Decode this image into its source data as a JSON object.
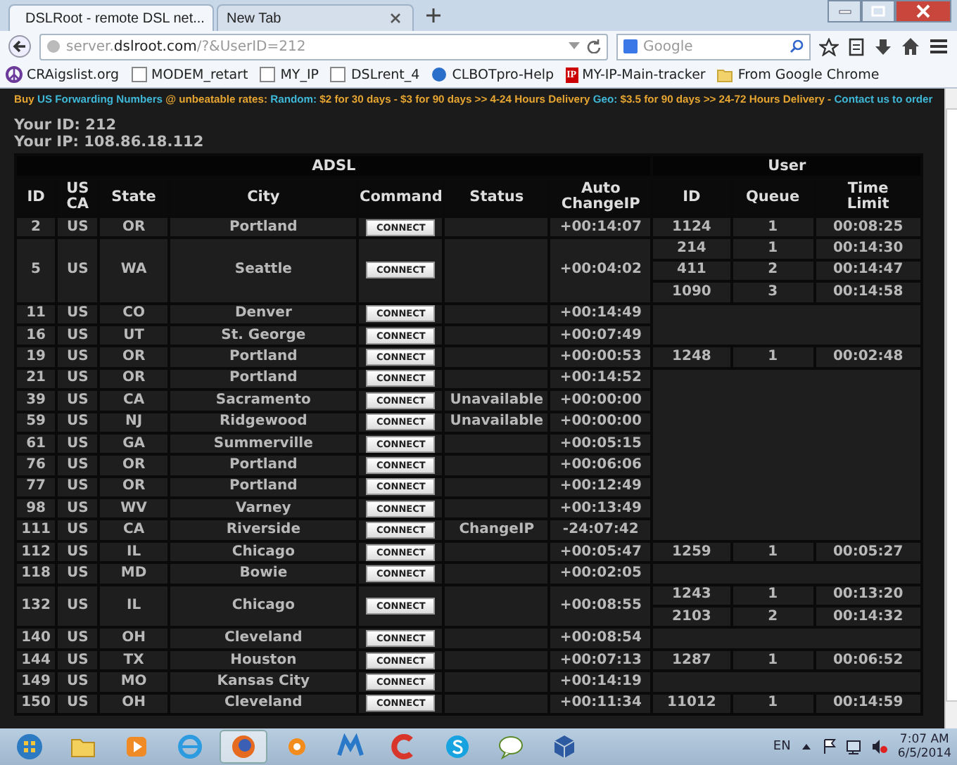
{
  "tabs": [
    {
      "label": "DSLRoot - remote DSL net...",
      "selected": true
    },
    {
      "label": "New Tab",
      "selected": false
    }
  ],
  "address": {
    "prefix": "server.",
    "domain": "dslroot.com",
    "path": "/?&UserID=212"
  },
  "search": {
    "placeholder": "Google"
  },
  "bookmarks": [
    {
      "label": "CRAigslist.org",
      "kind": "peace"
    },
    {
      "label": "MODEM_retart",
      "kind": "page"
    },
    {
      "label": "MY_IP",
      "kind": "page"
    },
    {
      "label": "DSLrent_4",
      "kind": "page"
    },
    {
      "label": "CLBOTpro-Help",
      "kind": "globe"
    },
    {
      "label": "MY-IP-Main-tracker",
      "kind": "ip",
      "badge": "IP"
    },
    {
      "label": "From Google Chrome",
      "kind": "folder"
    }
  ],
  "banner": [
    {
      "text": "Buy ",
      "kind": "text"
    },
    {
      "text": "US Forwarding Numbers",
      "kind": "link"
    },
    {
      "text": " @ unbeatable rates: ",
      "kind": "text"
    },
    {
      "text": "Random:",
      "kind": "link"
    },
    {
      "text": " $2 for 30 days - $3 for 90 days >> 4-24 Hours Delivery ",
      "kind": "text"
    },
    {
      "text": "Geo:",
      "kind": "link"
    },
    {
      "text": " $3.5 for 90 days >> 24-72 Hours Delivery - ",
      "kind": "text"
    },
    {
      "text": "Contact us to order",
      "kind": "link"
    }
  ],
  "your_id": "Your ID: 212",
  "your_ip": "Your IP: 108.86.18.112",
  "table": {
    "groups": [
      "ADSL",
      "User"
    ],
    "columns": [
      "ID",
      "US CA",
      "State",
      "City",
      "Command",
      "Status",
      "Auto ChangeIP",
      "ID",
      "Queue",
      "Time Limit"
    ],
    "rows": [
      {
        "id": "2",
        "country": "US",
        "state": "OR",
        "city": "Portland",
        "command": "CONNECT",
        "auto_changeip": "+00:14:07",
        "users": [
          {
            "id": "1124",
            "queue": "1",
            "time_limit": "00:08:25"
          }
        ]
      },
      {
        "id": "5",
        "country": "US",
        "state": "WA",
        "city": "Seattle",
        "command": "CONNECT",
        "auto_changeip": "+00:04:02",
        "users": [
          {
            "id": "214",
            "queue": "1",
            "time_limit": "00:14:30"
          },
          {
            "id": "411",
            "queue": "2",
            "time_limit": "00:14:47"
          },
          {
            "id": "1090",
            "queue": "3",
            "time_limit": "00:14:58"
          }
        ]
      },
      {
        "id": "11",
        "country": "US",
        "state": "CO",
        "city": "Denver",
        "command": "CONNECT",
        "auto_changeip": "+00:14:49",
        "users": []
      },
      {
        "id": "16",
        "country": "US",
        "state": "UT",
        "city": "St. George",
        "command": "CONNECT",
        "auto_changeip": "+00:07:49",
        "users": []
      },
      {
        "id": "19",
        "country": "US",
        "state": "OR",
        "city": "Portland",
        "command": "CONNECT",
        "auto_changeip": "+00:00:53",
        "users": [
          {
            "id": "1248",
            "queue": "1",
            "time_limit": "00:02:48"
          }
        ]
      },
      {
        "id": "21",
        "country": "US",
        "state": "OR",
        "city": "Portland",
        "command": "CONNECT",
        "auto_changeip": "+00:14:52",
        "users": []
      },
      {
        "id": "39",
        "country": "US",
        "state": "CA",
        "city": "Sacramento",
        "command": "CONNECT",
        "status": "Unavailable",
        "auto_changeip": "+00:00:00",
        "users": []
      },
      {
        "id": "59",
        "country": "US",
        "state": "NJ",
        "city": "Ridgewood",
        "command": "CONNECT",
        "status": "Unavailable",
        "auto_changeip": "+00:00:00",
        "users": []
      },
      {
        "id": "61",
        "country": "US",
        "state": "GA",
        "city": "Summerville",
        "command": "CONNECT",
        "auto_changeip": "+00:05:15",
        "users": []
      },
      {
        "id": "76",
        "country": "US",
        "state": "OR",
        "city": "Portland",
        "command": "CONNECT",
        "auto_changeip": "+00:06:06",
        "users": []
      },
      {
        "id": "77",
        "country": "US",
        "state": "OR",
        "city": "Portland",
        "command": "CONNECT",
        "auto_changeip": "+00:12:49",
        "users": []
      },
      {
        "id": "98",
        "country": "US",
        "state": "WV",
        "city": "Varney",
        "command": "CONNECT",
        "auto_changeip": "+00:13:49",
        "users": []
      },
      {
        "id": "111",
        "country": "US",
        "state": "CA",
        "city": "Riverside",
        "command": "CONNECT",
        "status": "ChangeIP",
        "auto_changeip": "-24:07:42",
        "users": []
      },
      {
        "id": "112",
        "country": "US",
        "state": "IL",
        "city": "Chicago",
        "command": "CONNECT",
        "auto_changeip": "+00:05:47",
        "users": [
          {
            "id": "1259",
            "queue": "1",
            "time_limit": "00:05:27"
          }
        ]
      },
      {
        "id": "118",
        "country": "US",
        "state": "MD",
        "city": "Bowie",
        "command": "CONNECT",
        "auto_changeip": "+00:02:05",
        "users": []
      },
      {
        "id": "132",
        "country": "US",
        "state": "IL",
        "city": "Chicago",
        "command": "CONNECT",
        "auto_changeip": "+00:08:55",
        "users": [
          {
            "id": "1243",
            "queue": "1",
            "time_limit": "00:13:20"
          },
          {
            "id": "2103",
            "queue": "2",
            "time_limit": "00:14:32"
          }
        ]
      },
      {
        "id": "140",
        "country": "US",
        "state": "OH",
        "city": "Cleveland",
        "command": "CONNECT",
        "auto_changeip": "+00:08:54",
        "users": []
      },
      {
        "id": "144",
        "country": "US",
        "state": "TX",
        "city": "Houston",
        "command": "CONNECT",
        "auto_changeip": "+00:07:13",
        "users": [
          {
            "id": "1287",
            "queue": "1",
            "time_limit": "00:06:52"
          }
        ]
      },
      {
        "id": "149",
        "country": "US",
        "state": "MO",
        "city": "Kansas City",
        "command": "CONNECT",
        "auto_changeip": "+00:14:19",
        "users": []
      },
      {
        "id": "150",
        "country": "US",
        "state": "OH",
        "city": "Cleveland",
        "command": "CONNECT",
        "auto_changeip": "+00:11:34",
        "users": [
          {
            "id": "11012",
            "queue": "1",
            "time_limit": "00:14:59"
          }
        ]
      }
    ]
  },
  "taskbar": {
    "apps": [
      {
        "kind": "explorer",
        "selected": false
      },
      {
        "kind": "media",
        "selected": false
      },
      {
        "kind": "ie",
        "selected": false
      },
      {
        "kind": "firefox",
        "selected": true
      },
      {
        "kind": "avast",
        "selected": false
      },
      {
        "kind": "malware",
        "selected": false
      },
      {
        "kind": "ccleaner",
        "selected": false
      },
      {
        "kind": "skype",
        "selected": false
      },
      {
        "kind": "talk",
        "selected": false
      },
      {
        "kind": "virtualbox",
        "selected": false
      }
    ],
    "language": "EN",
    "time": "7:07 AM",
    "date": "6/5/2014"
  }
}
